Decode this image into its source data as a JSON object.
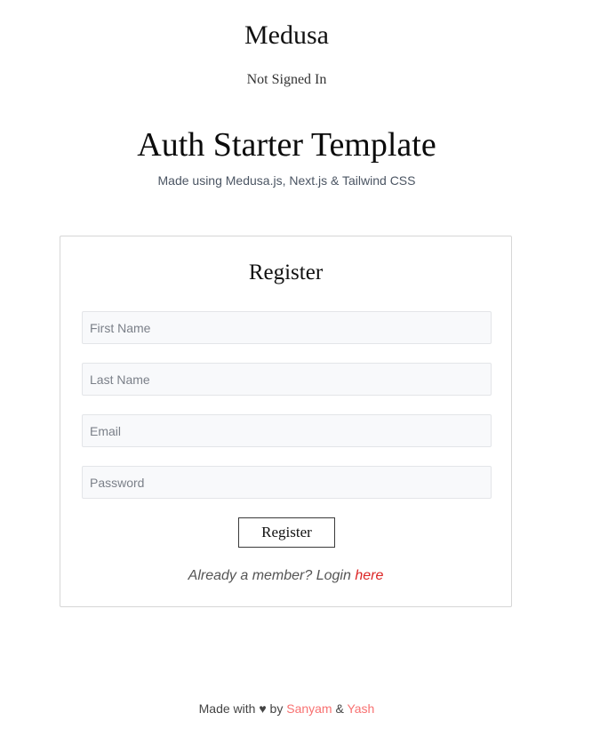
{
  "header": {
    "brand": "Medusa",
    "auth_status": "Not Signed In"
  },
  "hero": {
    "title": "Auth Starter Template",
    "subtitle": "Made using Medusa.js, Next.js & Tailwind CSS"
  },
  "register_form": {
    "title": "Register",
    "fields": {
      "first_name": {
        "placeholder": "First Name",
        "value": ""
      },
      "last_name": {
        "placeholder": "Last Name",
        "value": ""
      },
      "email": {
        "placeholder": "Email",
        "value": ""
      },
      "password": {
        "placeholder": "Password",
        "value": ""
      }
    },
    "submit_label": "Register",
    "switch_prompt": "Already a member? Login ",
    "switch_link_text": "here"
  },
  "footer": {
    "prefix": "Made with ",
    "heart_icon": "♥",
    "by_text": " by ",
    "author1": "Sanyam",
    "separator": " & ",
    "author2": "Yash"
  },
  "colors": {
    "link_red": "#dc2626",
    "footer_link": "#f87171",
    "input_bg": "#f8f9fb",
    "card_border": "#d6d6d6"
  }
}
